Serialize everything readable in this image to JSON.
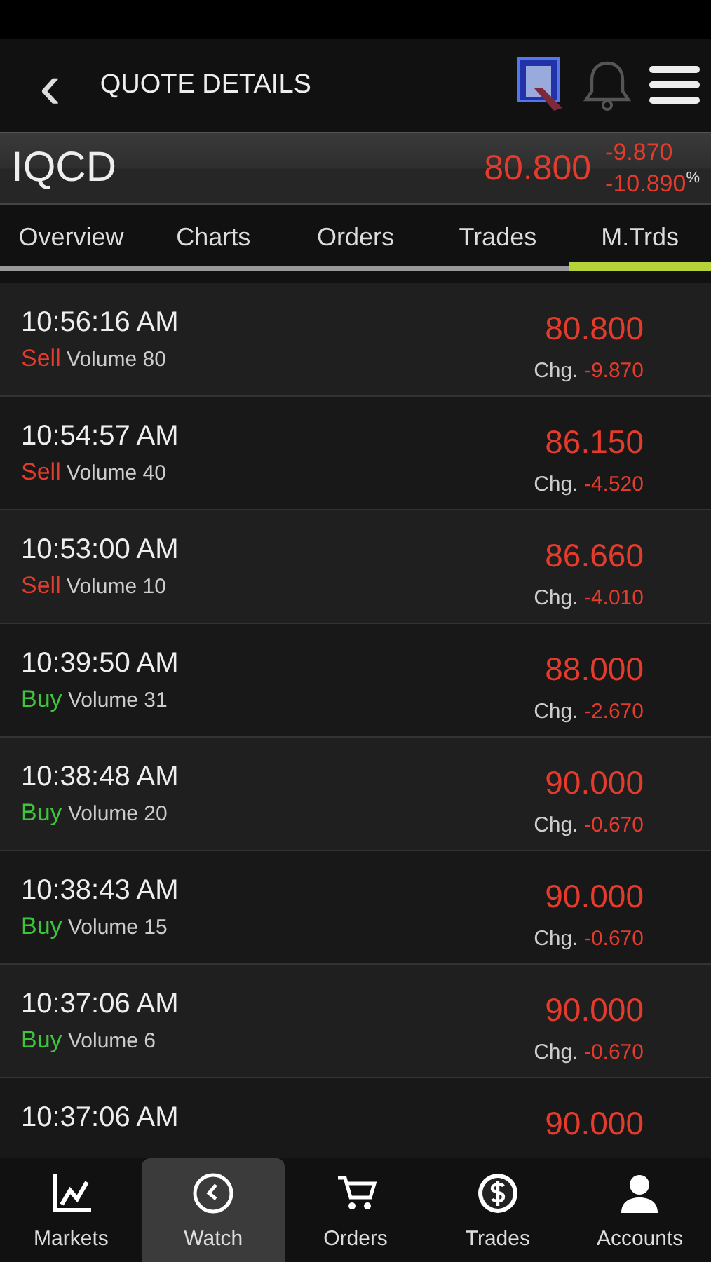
{
  "header": {
    "back": "‹",
    "title": "QUOTE DETAILS"
  },
  "quote": {
    "symbol": "IQCD",
    "price": "80.800",
    "change": "-9.870",
    "percent": "-10.890",
    "percent_sign": "%"
  },
  "tabs": [
    {
      "label": "Overview",
      "selected": false
    },
    {
      "label": "Charts",
      "selected": false
    },
    {
      "label": "Orders",
      "selected": false
    },
    {
      "label": "Trades",
      "selected": false
    },
    {
      "label": "M.Trds",
      "selected": true
    }
  ],
  "trades": [
    {
      "time": "10:56:16 AM",
      "kind": "sell",
      "side": "Sell",
      "volume": "Volume 80",
      "price": "80.800",
      "chg_label": "Chg.",
      "chg": "-9.870"
    },
    {
      "time": "10:54:57 AM",
      "kind": "sell",
      "side": "Sell",
      "volume": "Volume 40",
      "price": "86.150",
      "chg_label": "Chg.",
      "chg": "-4.520"
    },
    {
      "time": "10:53:00 AM",
      "kind": "sell",
      "side": "Sell",
      "volume": "Volume 10",
      "price": "86.660",
      "chg_label": "Chg.",
      "chg": "-4.010"
    },
    {
      "time": "10:39:50 AM",
      "kind": "buy",
      "side": "Buy",
      "volume": "Volume 31",
      "price": "88.000",
      "chg_label": "Chg.",
      "chg": "-2.670"
    },
    {
      "time": "10:38:48 AM",
      "kind": "buy",
      "side": "Buy",
      "volume": "Volume 20",
      "price": "90.000",
      "chg_label": "Chg.",
      "chg": "-0.670"
    },
    {
      "time": "10:38:43 AM",
      "kind": "buy",
      "side": "Buy",
      "volume": "Volume 15",
      "price": "90.000",
      "chg_label": "Chg.",
      "chg": "-0.670"
    },
    {
      "time": "10:37:06 AM",
      "kind": "buy",
      "side": "Buy",
      "volume": "Volume 6",
      "price": "90.000",
      "chg_label": "Chg.",
      "chg": "-0.670"
    },
    {
      "time": "10:37:06 AM",
      "price": "90.000"
    }
  ],
  "nav": [
    {
      "label": "Markets",
      "kind": "markets",
      "selected": false
    },
    {
      "label": "Watch",
      "kind": "watch",
      "selected": true
    },
    {
      "label": "Orders",
      "kind": "orders",
      "selected": false
    },
    {
      "label": "Trades",
      "kind": "trades",
      "selected": false
    },
    {
      "label": "Accounts",
      "kind": "accounts",
      "selected": false
    }
  ]
}
